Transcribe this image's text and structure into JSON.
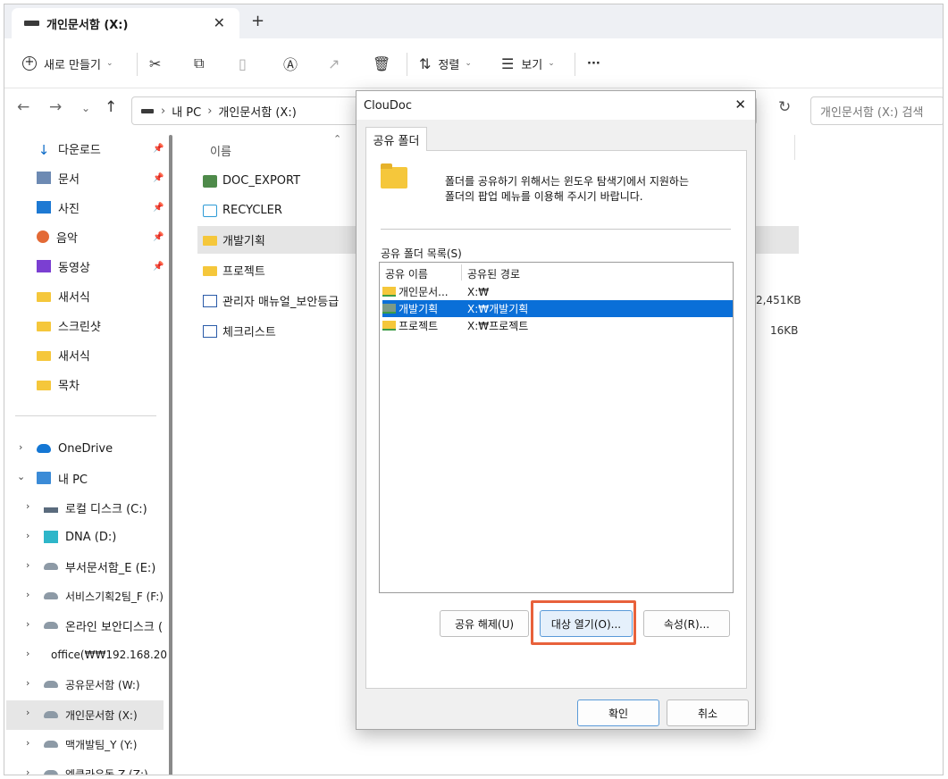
{
  "tab": {
    "title": "개인문서함 (X:)",
    "close": "✕",
    "add": "+"
  },
  "toolbar": {
    "new_label": "새로 만들기",
    "sort_label": "정렬",
    "view_label": "보기",
    "more_label": "···"
  },
  "address": {
    "crumbs": [
      "내 PC",
      "개인문서함 (X:)"
    ],
    "search_placeholder": "개인문서함 (X:) 검색"
  },
  "sidebar": {
    "quick": [
      {
        "label": "다운로드",
        "icon": "download-icon"
      },
      {
        "label": "문서",
        "icon": "document-icon"
      },
      {
        "label": "사진",
        "icon": "picture-icon"
      },
      {
        "label": "음악",
        "icon": "music-icon"
      },
      {
        "label": "동영상",
        "icon": "video-icon"
      },
      {
        "label": "새서식",
        "icon": "folder-icon"
      },
      {
        "label": "스크린샷",
        "icon": "folder-icon"
      },
      {
        "label": "새서식",
        "icon": "folder-icon"
      },
      {
        "label": "목차",
        "icon": "folder-icon"
      }
    ],
    "tree": [
      {
        "label": "OneDrive",
        "icon": "cloud-icon"
      },
      {
        "label": "내 PC",
        "icon": "pc-icon"
      },
      {
        "label": "로컬 디스크 (C:)",
        "icon": "drive-icon"
      },
      {
        "label": "DNA (D:)",
        "icon": "dna-drive-icon"
      },
      {
        "label": "부서문서함_E (E:)",
        "icon": "network-drive-icon"
      },
      {
        "label": "서비스기획2팀_F (F:)",
        "icon": "network-drive-icon"
      },
      {
        "label": "온라인 보안디스크 (",
        "icon": "network-drive-icon"
      },
      {
        "label": "office(₩₩192.168.20",
        "icon": "disconnected-drive-icon"
      },
      {
        "label": "공유문서함 (W:)",
        "icon": "network-drive-icon"
      },
      {
        "label": "개인문서함 (X:)",
        "icon": "network-drive-icon"
      },
      {
        "label": "맥개발팀_Y (Y:)",
        "icon": "network-drive-icon"
      },
      {
        "label": "엠클라우독 Z (Z:)",
        "icon": "network-drive-icon"
      }
    ]
  },
  "files": {
    "column_name": "이름",
    "rows": [
      {
        "name": "DOC_EXPORT",
        "size": "",
        "icon": "export-folder-icon"
      },
      {
        "name": "RECYCLER",
        "size": "",
        "icon": "recycler-icon"
      },
      {
        "name": "개발기획",
        "size": "",
        "icon": "folder-icon"
      },
      {
        "name": "프로젝트",
        "size": "",
        "icon": "folder-icon"
      },
      {
        "name": "관리자 매뉴얼_보안등급",
        "size": "2,451KB",
        "icon": "word-file-icon"
      },
      {
        "name": "체크리스트",
        "size": "16KB",
        "icon": "word-file-icon"
      }
    ]
  },
  "dialog": {
    "title": "ClouDoc",
    "tab_label": "공유 폴더",
    "notice_line1": "폴더를 공유하기 위해서는 윈도우 탐색기에서 지원하는",
    "notice_line2": "폴더의 팝업 메뉴를 이용해 주시기 바랍니다.",
    "list_label": "공유 폴더 목록(S)",
    "col_share_name": "공유 이름",
    "col_share_path": "공유된 경로",
    "shares": [
      {
        "name": "개인문서...",
        "path": "X:₩"
      },
      {
        "name": "개발기획",
        "path": "X:₩개발기획"
      },
      {
        "name": "프로젝트",
        "path": "X:₩프로젝트"
      }
    ],
    "btn_unshare": "공유 해제(U)",
    "btn_open": "대상 열기(O)...",
    "btn_props": "속성(R)...",
    "btn_ok": "확인",
    "btn_cancel": "취소"
  },
  "colors": {
    "selection": "#0a6fd8",
    "highlight_box": "#e8613b",
    "folder": "#f5c73b"
  }
}
